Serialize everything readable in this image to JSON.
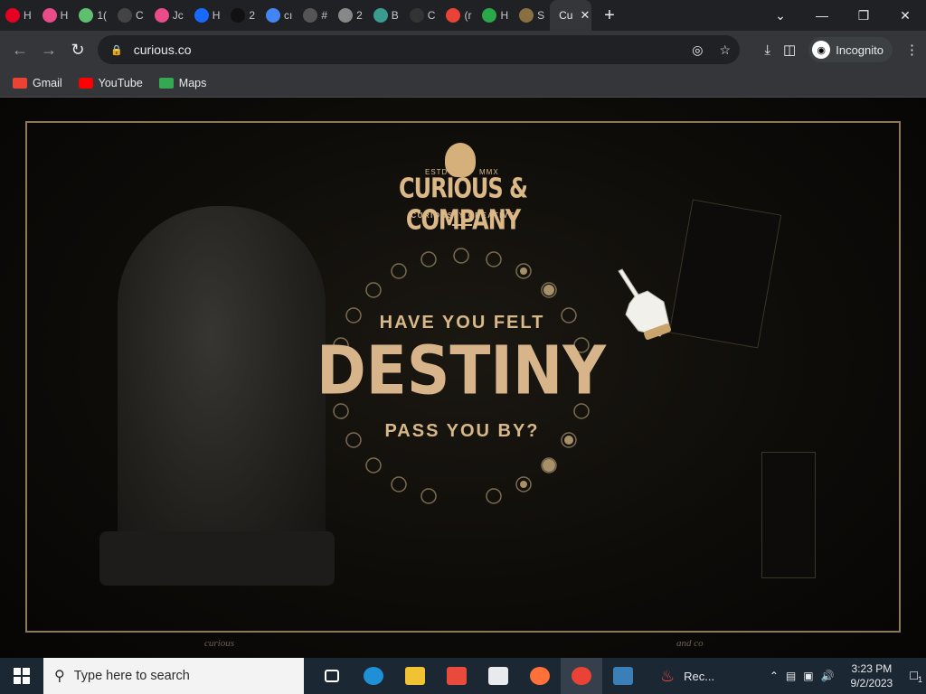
{
  "browser": {
    "tabs": [
      {
        "label": "H",
        "icon": "pinterest-icon",
        "color": "#e60023"
      },
      {
        "label": "H",
        "icon": "dribbble-icon",
        "color": "#ea4c89"
      },
      {
        "label": "1(",
        "icon": "colorful-icon",
        "color": "#5fbf6f"
      },
      {
        "label": "C",
        "icon": "circle-icon",
        "color": "#444444"
      },
      {
        "label": "Jc",
        "icon": "dribbble-icon",
        "color": "#ea4c89"
      },
      {
        "label": "H",
        "icon": "behance-icon",
        "color": "#1769ff"
      },
      {
        "label": "2",
        "icon": "unsplash-icon",
        "color": "#111111"
      },
      {
        "label": "cı",
        "icon": "google-icon",
        "color": "#4285f4"
      },
      {
        "label": "#",
        "icon": "generic-icon",
        "color": "#555555"
      },
      {
        "label": "2",
        "icon": "webflow-icon",
        "color": "#888888"
      },
      {
        "label": "B",
        "icon": "d-icon",
        "color": "#3a9c8f"
      },
      {
        "label": "C",
        "icon": "codepen-icon",
        "color": "#333333"
      },
      {
        "label": "(r",
        "icon": "gmail-icon",
        "color": "#ea4335"
      },
      {
        "label": "H",
        "icon": "w-icon",
        "color": "#2aa84a"
      },
      {
        "label": "S",
        "icon": "cartoon-icon",
        "color": "#8a7040"
      },
      {
        "label": "Cu",
        "icon": "curious-icon",
        "color": "#c9a46d",
        "active": true
      }
    ],
    "new_tab": "+",
    "url": "curious.co",
    "profile_label": "Incognito",
    "bookmarks": [
      {
        "label": "Gmail",
        "color": "#ea4335"
      },
      {
        "label": "YouTube",
        "color": "#ff0000"
      },
      {
        "label": "Maps",
        "color": "#34a853"
      }
    ]
  },
  "site": {
    "estd": "ESTD",
    "mmx": "MMX",
    "logo_name": "CURIOUS & COMPANY",
    "logo_tagline": "CURIOUSLY CREATIVE",
    "headline_top": "HAVE YOU FELT",
    "headline_main": "DESTINY",
    "headline_bottom": "PASS YOU BY?",
    "footer_left": "curious",
    "footer_right": "and co"
  },
  "taskbar": {
    "search_placeholder": "Type here to search",
    "running_app_label": "Rec...",
    "time": "3:23 PM",
    "date": "9/2/2023",
    "notification_count": "1"
  }
}
